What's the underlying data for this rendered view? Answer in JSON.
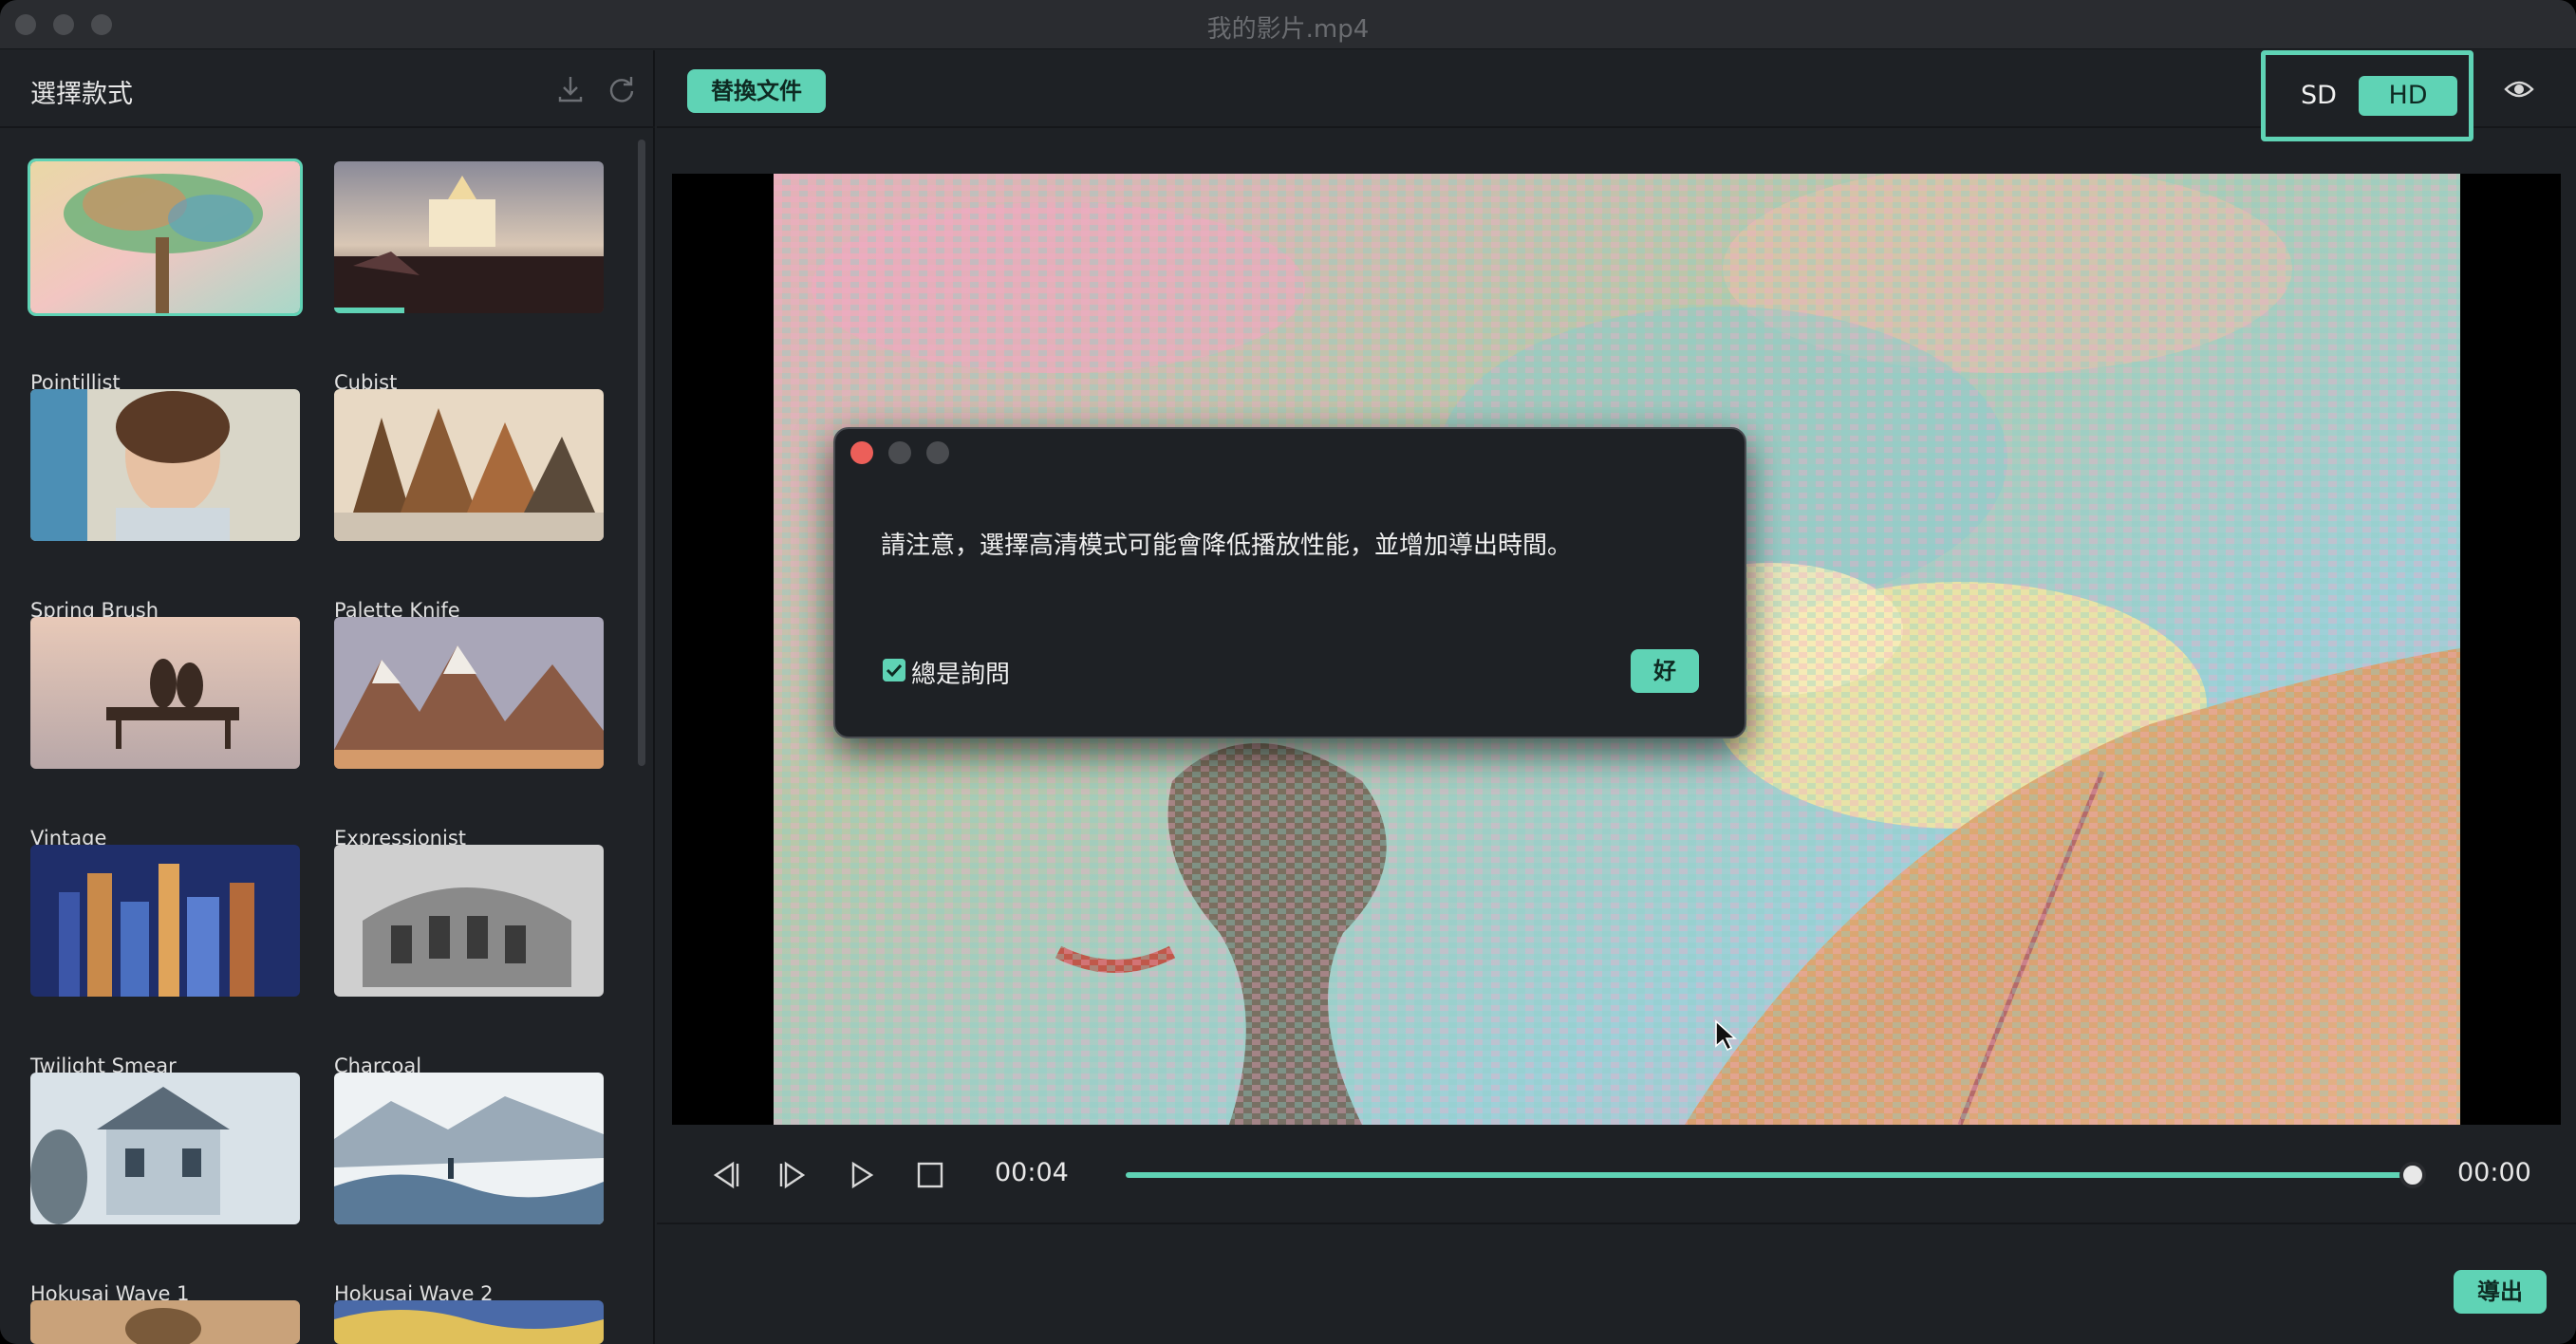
{
  "window": {
    "title": "我的影片.mp4"
  },
  "sidebar": {
    "title": "選擇款式",
    "styles": [
      {
        "label": "Pointillist",
        "selected": true
      },
      {
        "label": "Cubist",
        "progress": 0.26
      },
      {
        "label": "Spring Brush"
      },
      {
        "label": "Palette Knife"
      },
      {
        "label": "Vintage"
      },
      {
        "label": "Expressionist"
      },
      {
        "label": "Twilight Smear"
      },
      {
        "label": "Charcoal"
      },
      {
        "label": "Hokusai Wave 1"
      },
      {
        "label": "Hokusai Wave 2"
      }
    ]
  },
  "toolbar": {
    "replace_label": "替換文件",
    "sd_label": "SD",
    "hd_label": "HD",
    "quality_selected": "HD"
  },
  "player": {
    "current_time": "00:04",
    "end_time": "00:00",
    "progress": 1.0
  },
  "bottom": {
    "export_label": "導出"
  },
  "dialog": {
    "message": "請注意，選擇高清模式可能會降低播放性能，並增加導出時間。",
    "checkbox_label": "總是詢問",
    "checkbox_checked": true,
    "ok_label": "好"
  },
  "colors": {
    "accent": "#5fd3b5",
    "background": "#1e2125",
    "close": "#ec5f59"
  }
}
